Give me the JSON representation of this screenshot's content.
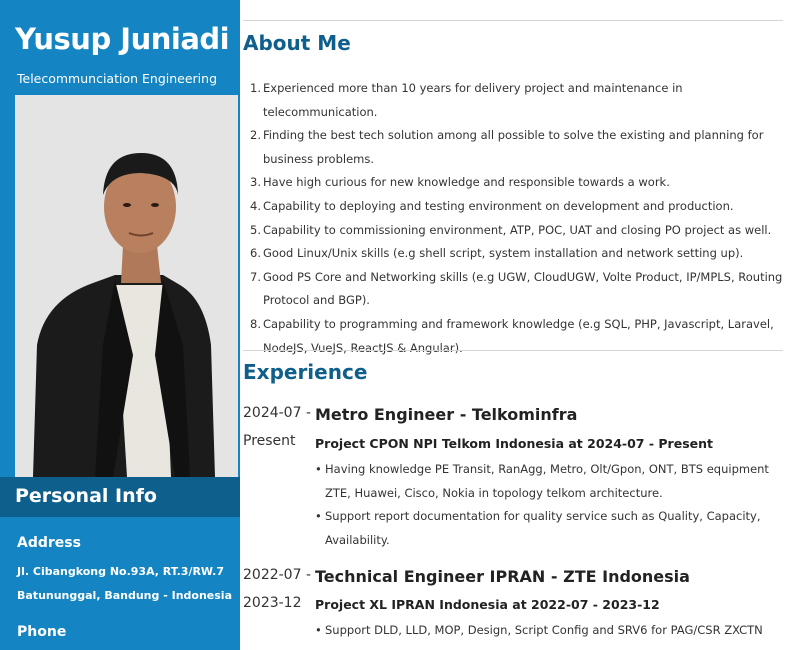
{
  "sidebar": {
    "name": "Yusup Juniadi",
    "subtitle": "Telecommunciation Engineering",
    "personal_info_heading": "Personal Info",
    "address_label": "Address",
    "address_line1": "Jl. Cibangkong No.93A, RT.3/RW.7",
    "address_line2": "Batununggal, Bandung - Indonesia",
    "phone_label": "Phone"
  },
  "about": {
    "heading": "About Me",
    "items": [
      {
        "num": "1.",
        "text": "Experienced more than 10 years for delivery project and maintenance in telecommunication."
      },
      {
        "num": "2.",
        "text": "Finding the best tech solution among all possible to solve the existing and planning for business problems."
      },
      {
        "num": "3.",
        "text": "Have high curious for new knowledge and responsible towards a work."
      },
      {
        "num": "4.",
        "text": "Capability to deploying and testing environment on development and production."
      },
      {
        "num": "5.",
        "text": "Capability to commissioning environment, ATP, POC, UAT and closing PO project as well."
      },
      {
        "num": "6.",
        "text": "Good Linux/Unix skills (e.g shell script, system installation and network setting up)."
      },
      {
        "num": "7.",
        "text": "Good PS Core and Networking skills (e.g UGW, CloudUGW, Volte Product, IP/MPLS, Routing Protocol and BGP)."
      },
      {
        "num": "8.",
        "text": "Capability to programming and framework knowledge (e.g SQL, PHP, Javascript, Laravel, NodeJS, VueJS, ReactJS & Angular)."
      }
    ]
  },
  "experience": {
    "heading": "Experience",
    "entries": [
      {
        "date_start": "2024-07 -",
        "date_end": "Present",
        "title": "Metro Engineer - Telkominfra",
        "project": "Project CPON NPI Telkom Indonesia at 2024-07 - Present",
        "bullets": [
          "Having knowledge PE Transit, RanAgg, Metro, Olt/Gpon, ONT, BTS equipment ZTE, Huawei, Cisco, Nokia in topology telkom architecture.",
          "Support report documentation for quality service such as Quality, Capacity, Availability."
        ]
      },
      {
        "date_start": "2022-07 -",
        "date_end": "2023-12",
        "title": "Technical Engineer IPRAN - ZTE Indonesia",
        "project": "Project XL IPRAN Indonesia at 2022-07 - 2023-12",
        "bullets": [
          "Support DLD, LLD, MOP, Design, Script Config and SRV6 for PAG/CSR ZXCTN"
        ]
      }
    ]
  }
}
